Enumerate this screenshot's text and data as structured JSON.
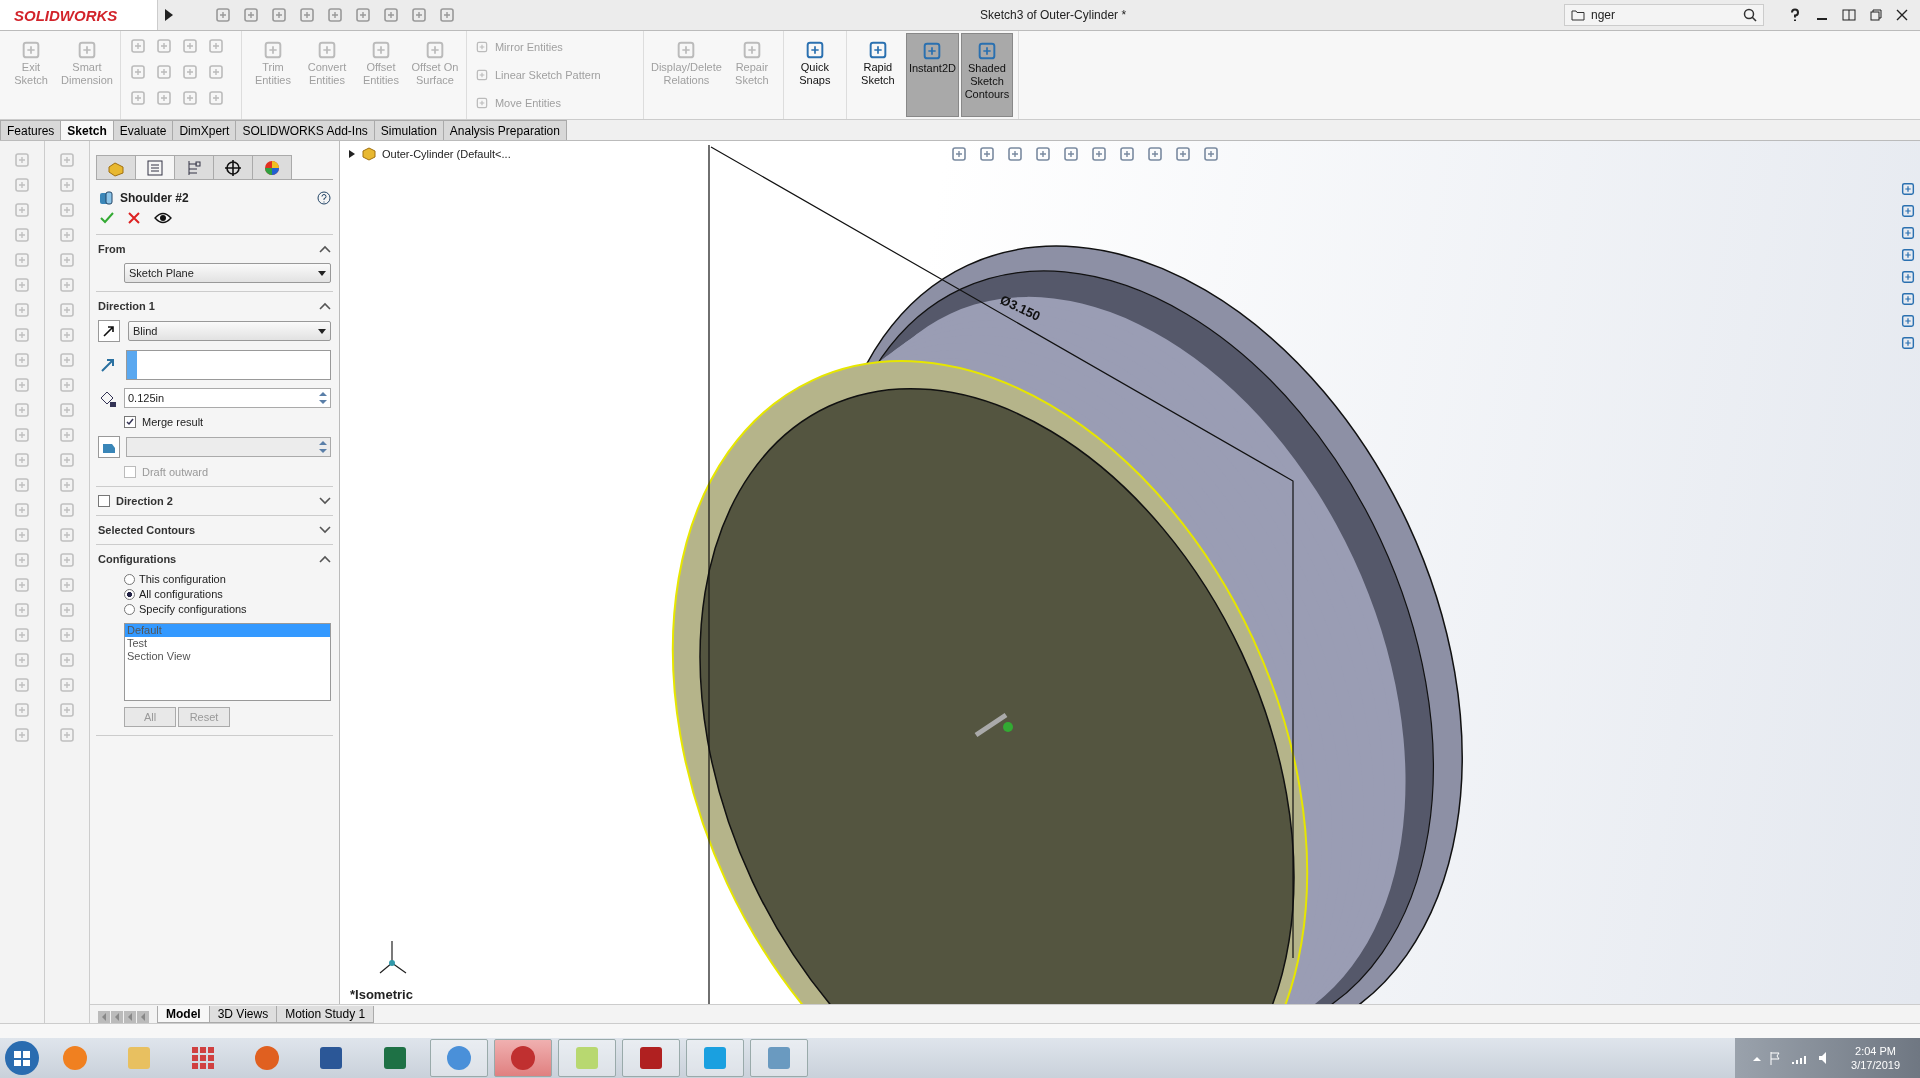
{
  "title_bar": {
    "logo": "SOLIDWORKS",
    "document_title": "Sketch3 of Outer-Cylinder *",
    "search": {
      "value": "nger"
    }
  },
  "ribbon": {
    "groups": [
      {
        "kind": "large",
        "tools": [
          {
            "label": "Exit Sketch",
            "disabled": true,
            "pressed": false
          },
          {
            "label": "Smart Dimension",
            "disabled": true,
            "pressed": false
          }
        ]
      },
      {
        "kind": "grid"
      },
      {
        "kind": "large",
        "tools": [
          {
            "label": "Trim Entities",
            "disabled": true,
            "pressed": false
          },
          {
            "label": "Convert Entities",
            "disabled": true,
            "pressed": false
          },
          {
            "label": "Offset Entities",
            "disabled": true,
            "pressed": false
          },
          {
            "label": "Offset On Surface",
            "disabled": true,
            "pressed": false
          }
        ]
      },
      {
        "kind": "small",
        "tools": [
          {
            "label": "Mirror Entities",
            "disabled": true,
            "pressed": false
          },
          {
            "label": "Linear Sketch Pattern",
            "disabled": true,
            "pressed": false
          },
          {
            "label": "Move Entities",
            "disabled": true,
            "pressed": false
          }
        ]
      },
      {
        "kind": "large",
        "tools": [
          {
            "label": "Display/Delete Relations",
            "disabled": true,
            "pressed": false
          },
          {
            "label": "Repair Sketch",
            "disabled": true,
            "pressed": false
          }
        ]
      },
      {
        "kind": "large",
        "tools": [
          {
            "label": "Quick Snaps",
            "disabled": false,
            "pressed": false
          }
        ]
      },
      {
        "kind": "large",
        "tools": [
          {
            "label": "Rapid Sketch",
            "disabled": false,
            "pressed": false
          },
          {
            "label": "Instant2D",
            "disabled": false,
            "pressed": true
          },
          {
            "label": "Shaded Sketch Contours",
            "disabled": false,
            "pressed": true
          }
        ]
      }
    ]
  },
  "command_tabs": [
    {
      "label": "Features",
      "selected": false
    },
    {
      "label": "Sketch",
      "selected": true
    },
    {
      "label": "Evaluate",
      "selected": false
    },
    {
      "label": "DimXpert",
      "selected": false
    },
    {
      "label": "SOLIDWORKS Add-Ins",
      "selected": false
    },
    {
      "label": "Simulation",
      "selected": false
    },
    {
      "label": "Analysis Preparation",
      "selected": false
    }
  ],
  "property_manager": {
    "tabs": [
      {
        "kind": "feature_tree",
        "selected": false
      },
      {
        "kind": "property_manager",
        "selected": true
      },
      {
        "kind": "configuration_manager",
        "selected": false
      },
      {
        "kind": "dimxpert",
        "selected": false
      },
      {
        "kind": "display_manager",
        "selected": false
      }
    ],
    "title": "Shoulder #2",
    "sections": [
      {
        "kind": "from",
        "title": "From",
        "expanded": true,
        "value": "Sketch Plane"
      },
      {
        "kind": "direction",
        "title": "Direction 1",
        "expanded": true,
        "end_condition": "Blind",
        "depth": "0.125in",
        "merge_result": {
          "label": "Merge result",
          "checked": true
        },
        "draft_outward": {
          "label": "Draft outward",
          "checked": false,
          "disabled": true
        }
      },
      {
        "kind": "toggle",
        "title": "Direction 2",
        "checked": false,
        "expanded": false
      },
      {
        "kind": "plain",
        "title": "Selected Contours",
        "expanded": false
      },
      {
        "kind": "configurations",
        "title": "Configurations",
        "expanded": true,
        "options": [
          {
            "label": "This configuration",
            "selected": false
          },
          {
            "label": "All configurations",
            "selected": true
          },
          {
            "label": "Specify configurations",
            "selected": false
          }
        ],
        "list": [
          {
            "label": "Default",
            "selected": true
          },
          {
            "label": "Test",
            "selected": false
          },
          {
            "label": "Section View",
            "selected": false
          }
        ],
        "buttons": [
          {
            "label": "All",
            "disabled": true
          },
          {
            "label": "Reset",
            "disabled": true
          }
        ]
      }
    ]
  },
  "feature_tree": {
    "items": [
      {
        "label": "Outer-Cylinder (Default<...",
        "expanded": false
      }
    ]
  },
  "viewport": {
    "view_label": "*Isometric",
    "dimension": "Ø3.150"
  },
  "bottom_tabs": [
    {
      "label": "Model",
      "selected": true
    },
    {
      "label": "3D Views",
      "selected": false
    },
    {
      "label": "Motion Study 1",
      "selected": false
    }
  ],
  "taskbar": {
    "apps": [
      {
        "kind": "media",
        "running": false,
        "active": false
      },
      {
        "kind": "explorer",
        "running": false,
        "active": false
      },
      {
        "kind": "apps",
        "running": false,
        "active": false
      },
      {
        "kind": "firefox",
        "running": false,
        "active": false
      },
      {
        "kind": "word",
        "running": false,
        "active": false
      },
      {
        "kind": "excel",
        "running": false,
        "active": false
      },
      {
        "kind": "chrome",
        "running": true,
        "active": false
      },
      {
        "kind": "snipping",
        "running": true,
        "active": true
      },
      {
        "kind": "notes",
        "running": true,
        "active": false
      },
      {
        "kind": "cad",
        "running": true,
        "active": false
      },
      {
        "kind": "c",
        "running": true,
        "active": false
      },
      {
        "kind": "calculator",
        "running": true,
        "active": false
      }
    ],
    "time": "2:04 PM",
    "date": "3/17/2019"
  }
}
